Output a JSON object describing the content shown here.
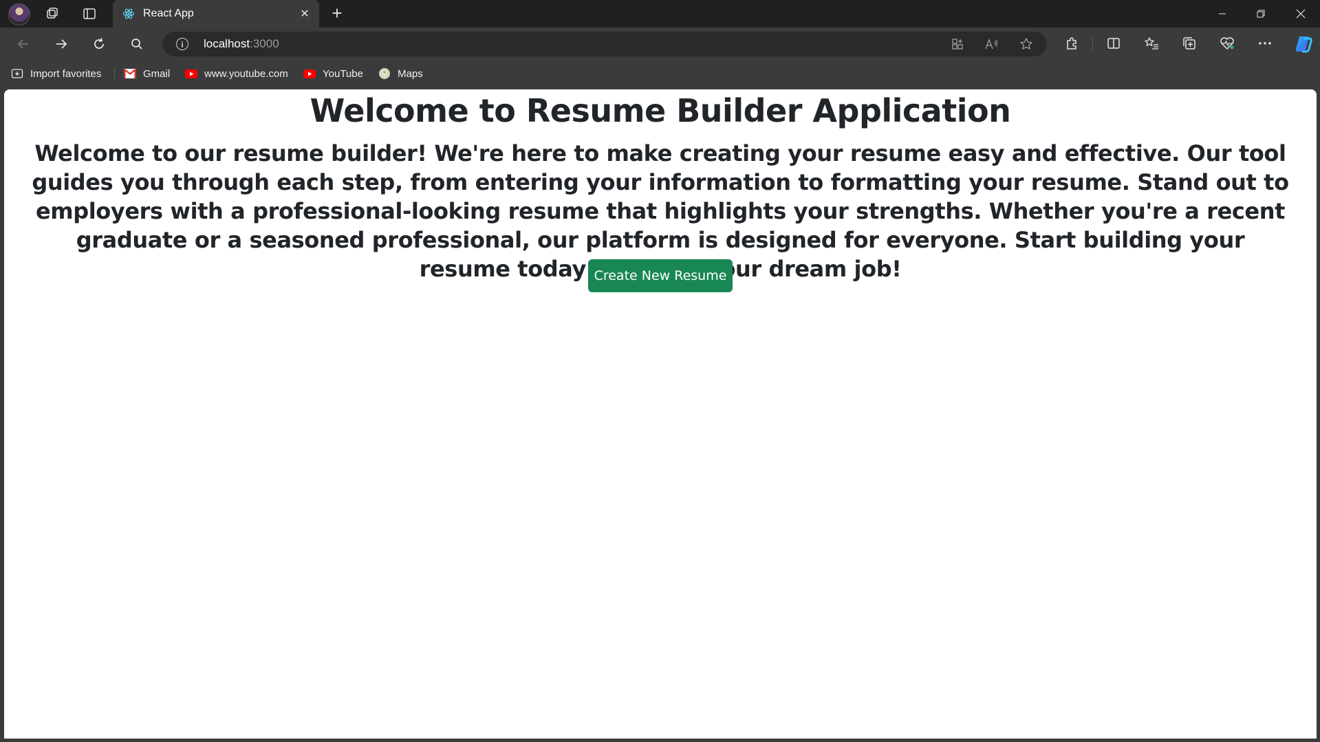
{
  "browser": {
    "tab": {
      "title": "React App"
    },
    "address_bar": {
      "host": "localhost",
      "port": ":3000"
    },
    "bookmarks": [
      {
        "label": "Import favorites",
        "icon": "import-favorites-icon"
      },
      {
        "label": "Gmail",
        "icon": "gmail-icon"
      },
      {
        "label": "www.youtube.com",
        "icon": "youtube-icon"
      },
      {
        "label": "YouTube",
        "icon": "youtube-icon"
      },
      {
        "label": "Maps",
        "icon": "maps-icon"
      }
    ],
    "colors": {
      "chrome_dark": "#202020",
      "chrome": "#3b3b3b",
      "copilot": "#2f80ed"
    }
  },
  "page": {
    "title": "Welcome to Resume Builder Application",
    "intro": "Welcome to our resume builder! We're here to make creating your resume easy and effective. Our tool guides you through each step, from entering your information to formatting your resume. Stand out to employers with a professional-looking resume that highlights your strengths. Whether you're a recent graduate or a seasoned professional, our platform is designed for everyone. Start building your resume today and land your dream job!",
    "create_button": "Create New Resume",
    "colors": {
      "button": "#198754",
      "text": "#212529"
    }
  }
}
